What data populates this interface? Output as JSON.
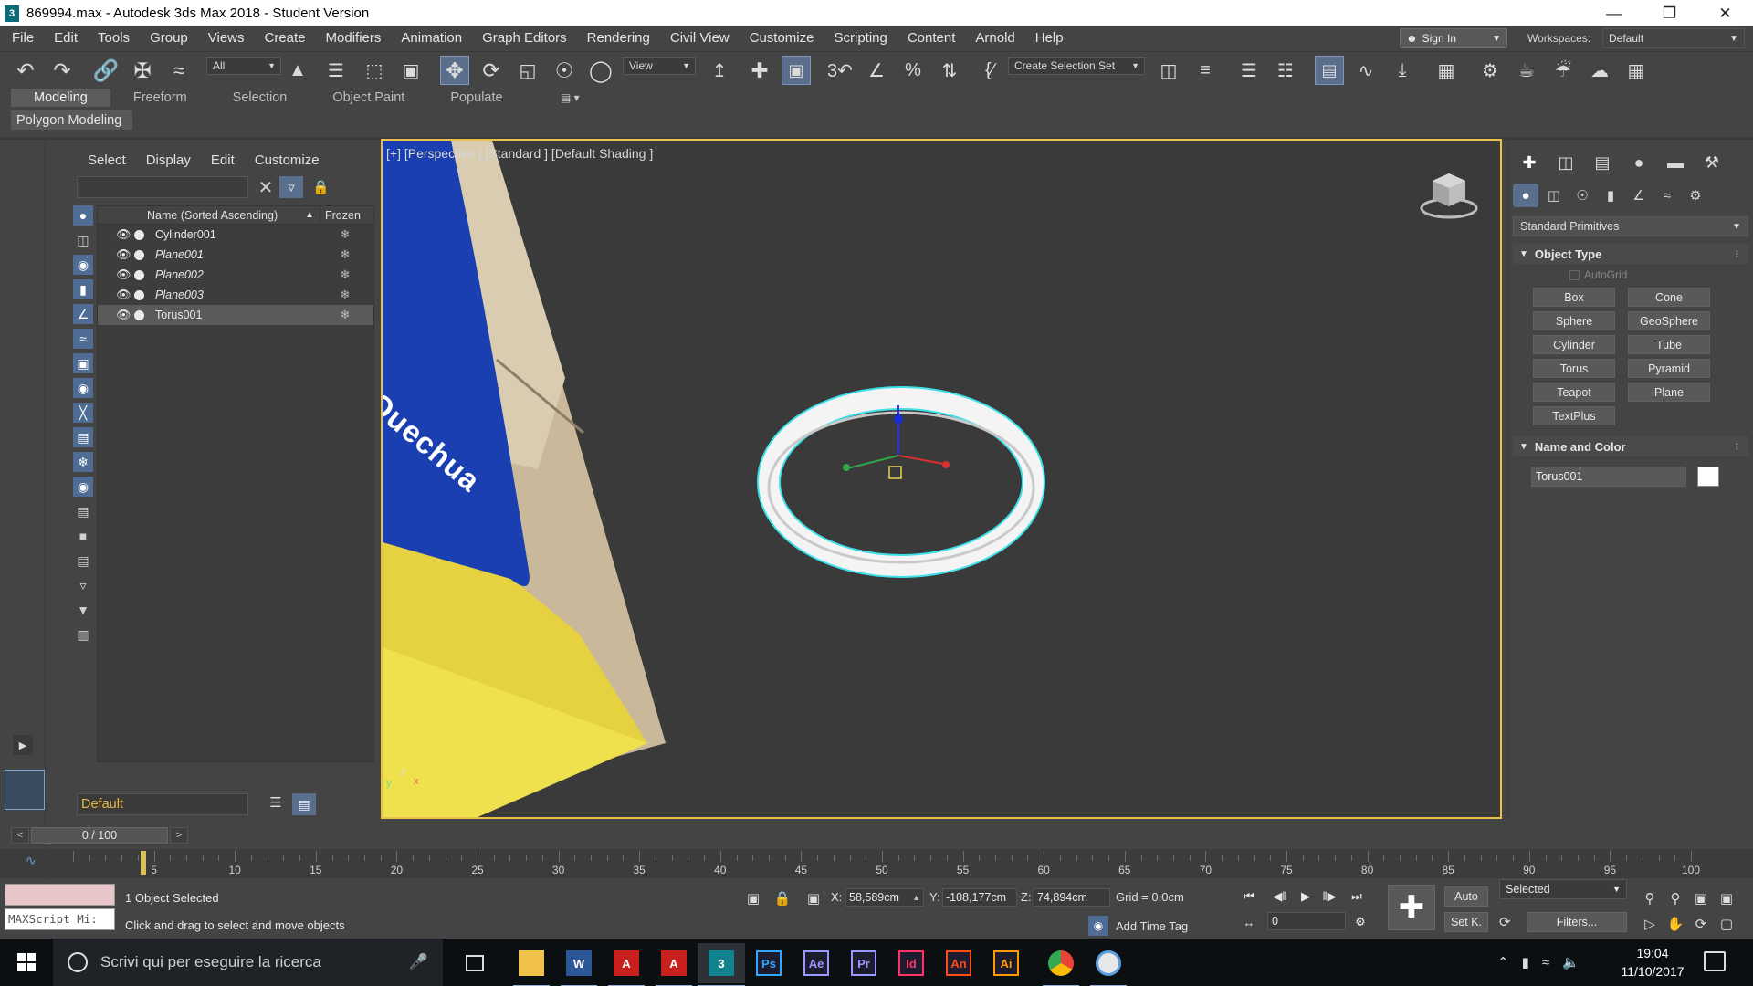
{
  "window": {
    "title": "869994.max - Autodesk 3ds Max 2018 - Student Version",
    "app_icon_text": "3"
  },
  "menu": [
    "File",
    "Edit",
    "Tools",
    "Group",
    "Views",
    "Create",
    "Modifiers",
    "Animation",
    "Graph Editors",
    "Rendering",
    "Civil View",
    "Customize",
    "Scripting",
    "Content",
    "Arnold",
    "Help"
  ],
  "account": {
    "sign_in": "Sign In",
    "workspaces_label": "Workspaces:",
    "workspace": "Default"
  },
  "toolbar": {
    "selection_filter": "All",
    "ref_coord": "View",
    "named_selection": "Create Selection Set"
  },
  "ribbon": {
    "tabs": [
      "Modeling",
      "Freeform",
      "Selection",
      "Object Paint",
      "Populate"
    ],
    "active_tab": "Modeling",
    "panel_label": "Polygon Modeling"
  },
  "scene_explorer": {
    "menu": [
      "Select",
      "Display",
      "Edit",
      "Customize"
    ],
    "search_value": "",
    "columns": {
      "name": "Name (Sorted Ascending)",
      "frozen": "Frozen"
    },
    "rows": [
      {
        "name": "Cylinder001",
        "italic": false,
        "selected": false
      },
      {
        "name": "Plane001",
        "italic": true,
        "selected": false
      },
      {
        "name": "Plane002",
        "italic": true,
        "selected": false
      },
      {
        "name": "Plane003",
        "italic": true,
        "selected": false
      },
      {
        "name": "Torus001",
        "italic": false,
        "selected": true
      }
    ],
    "layer": "Default"
  },
  "viewport": {
    "label": "[+] [Perspective ] [Standard ] [Default Shading ]",
    "texture_text": "Quechua",
    "border_color": "#e8c24a",
    "axis_labels": {
      "z": "z",
      "y": "y",
      "x": "x"
    }
  },
  "command_panel": {
    "category": "Standard Primitives",
    "object_type_title": "Object Type",
    "autogrid": "AutoGrid",
    "primitives": [
      "Box",
      "Cone",
      "Sphere",
      "GeoSphere",
      "Cylinder",
      "Tube",
      "Torus",
      "Pyramid",
      "Teapot",
      "Plane",
      "TextPlus"
    ],
    "name_color_title": "Name and Color",
    "object_name": "Torus001",
    "object_color": "#ffffff"
  },
  "timeline": {
    "slider": "0 / 100",
    "ticks": [
      "5",
      "10",
      "15",
      "20",
      "25",
      "30",
      "35",
      "40",
      "45",
      "50",
      "55",
      "60",
      "65",
      "70",
      "75",
      "80",
      "85",
      "90",
      "95",
      "100"
    ]
  },
  "status": {
    "maxscript": "MAXScript Mi:",
    "selection": "1 Object Selected",
    "prompt": "Click and drag to select and move objects",
    "x_label": "X:",
    "x": "58,589cm",
    "y_label": "Y:",
    "y": "-108,177cm",
    "z_label": "Z:",
    "z": "74,894cm",
    "grid": "Grid = 0,0cm",
    "add_time_tag": "Add Time Tag",
    "frame": "0",
    "auto": "Auto",
    "set_key": "Set K.",
    "key_filter": "Selected",
    "filters": "Filters..."
  },
  "taskbar": {
    "search_placeholder": "Scrivi qui per eseguire la ricerca",
    "apps": [
      {
        "name": "file-explorer",
        "label": "",
        "color": "#f0c24a"
      },
      {
        "name": "word",
        "label": "W",
        "color": "#2b5797"
      },
      {
        "name": "acrobat",
        "label": "A",
        "color": "#c8201d"
      },
      {
        "name": "autocad",
        "label": "A",
        "color": "#c8201d"
      },
      {
        "name": "3ds-max",
        "label": "3",
        "color": "#13828f"
      },
      {
        "name": "photoshop",
        "label": "Ps",
        "color": "#31a8ff"
      },
      {
        "name": "after-effects",
        "label": "Ae",
        "color": "#9999ff"
      },
      {
        "name": "premiere",
        "label": "Pr",
        "color": "#9999ff"
      },
      {
        "name": "indesign",
        "label": "Id",
        "color": "#ff3366"
      },
      {
        "name": "animate",
        "label": "An",
        "color": "#ff4a1a"
      },
      {
        "name": "illustrator",
        "label": "Ai",
        "color": "#ff9a00"
      },
      {
        "name": "chrome",
        "label": "",
        "color": "#4caf50"
      },
      {
        "name": "paint",
        "label": "",
        "color": "#e8e8e8"
      }
    ],
    "time": "19:04",
    "date": "11/10/2017"
  }
}
